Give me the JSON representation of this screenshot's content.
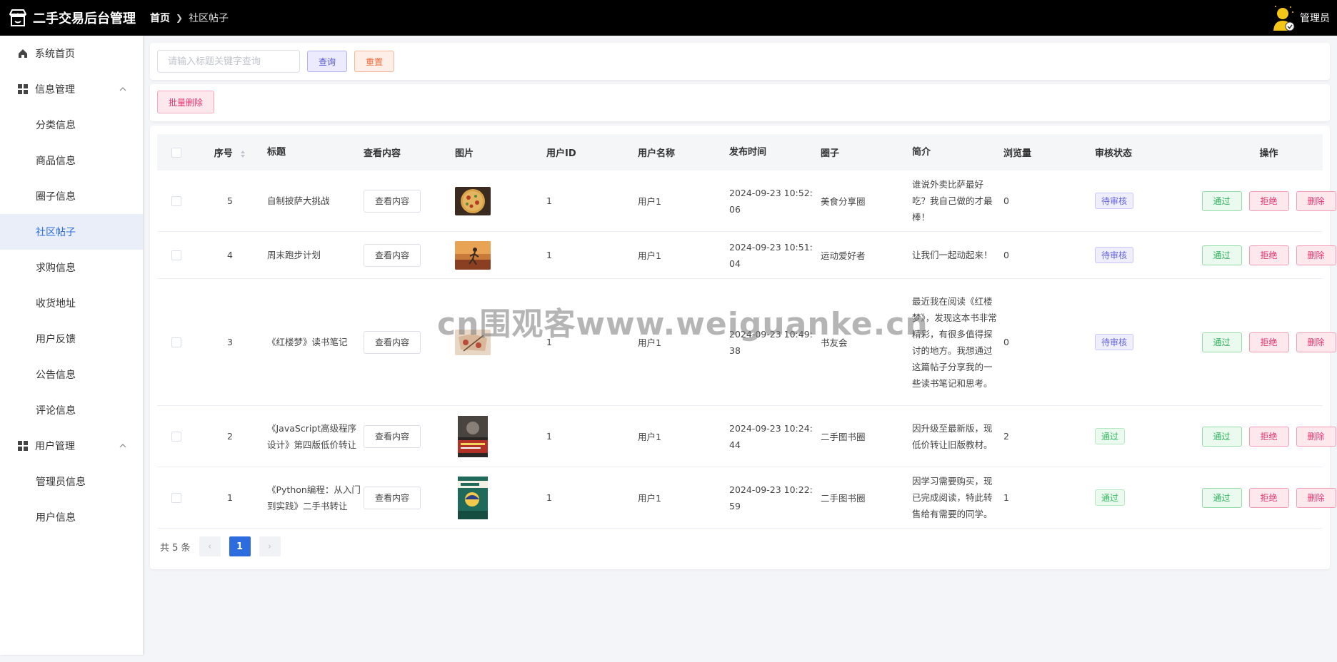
{
  "app": {
    "title": "二手交易后台管理",
    "user": "管理员"
  },
  "breadcrumb": {
    "home": "首页",
    "current": "社区帖子"
  },
  "sidebar": {
    "items": [
      {
        "label": "系统首页",
        "type": "top",
        "icon": "home-icon"
      },
      {
        "label": "信息管理",
        "type": "group",
        "icon": "grid-icon"
      },
      {
        "label": "分类信息",
        "type": "sub"
      },
      {
        "label": "商品信息",
        "type": "sub"
      },
      {
        "label": "圈子信息",
        "type": "sub"
      },
      {
        "label": "社区帖子",
        "type": "sub",
        "active": true
      },
      {
        "label": "求购信息",
        "type": "sub"
      },
      {
        "label": "收货地址",
        "type": "sub"
      },
      {
        "label": "用户反馈",
        "type": "sub"
      },
      {
        "label": "公告信息",
        "type": "sub"
      },
      {
        "label": "评论信息",
        "type": "sub"
      },
      {
        "label": "用户管理",
        "type": "group",
        "icon": "grid-icon"
      },
      {
        "label": "管理员信息",
        "type": "sub"
      },
      {
        "label": "用户信息",
        "type": "sub"
      }
    ]
  },
  "search": {
    "placeholder": "请输入标题关键字查询",
    "query_label": "查询",
    "reset_label": "重置"
  },
  "batch": {
    "delete_label": "批量删除"
  },
  "table": {
    "headers": [
      "序号",
      "标题",
      "查看内容",
      "图片",
      "用户ID",
      "用户名称",
      "发布时间",
      "圈子",
      "简介",
      "浏览量",
      "审核状态",
      "操作"
    ],
    "view_label": "查看内容",
    "ops": {
      "pass": "通过",
      "reject": "拒绝",
      "delete": "删除"
    },
    "rows": [
      {
        "idx": "5",
        "title": "自制披萨大挑战",
        "uid": "1",
        "uname": "用户1",
        "time": "2024-09-23 10:52:06",
        "circle": "美食分享圈",
        "intro": "谁说外卖比萨最好吃？我自己做的才最棒！",
        "views": "0",
        "status": "待审核",
        "status_type": "pending",
        "img": "pizza"
      },
      {
        "idx": "4",
        "title": "周末跑步计划",
        "uid": "1",
        "uname": "用户1",
        "time": "2024-09-23 10:51:04",
        "circle": "运动爱好者",
        "intro": "让我们一起动起来！",
        "views": "0",
        "status": "待审核",
        "status_type": "pending",
        "img": "run"
      },
      {
        "idx": "3",
        "title": "《红楼梦》读书笔记",
        "uid": "1",
        "uname": "用户1",
        "time": "2024-09-23 10:49:38",
        "circle": "书友会",
        "intro": "最近我在阅读《红楼梦》，发现这本书非常精彩，有很多值得探讨的地方。我想通过这篇帖子分享我的一些读书笔记和思考。",
        "views": "0",
        "status": "待审核",
        "status_type": "pending",
        "img": "book"
      },
      {
        "idx": "2",
        "title": "《JavaScript高级程序设计》第四版低价转让",
        "uid": "1",
        "uname": "用户1",
        "time": "2024-09-23 10:24:44",
        "circle": "二手图书圈",
        "intro": "因升级至最新版，现低价转让旧版教材。",
        "views": "2",
        "status": "通过",
        "status_type": "pass",
        "img": "js"
      },
      {
        "idx": "1",
        "title": "《Python编程：从入门到实践》二手书转让",
        "uid": "1",
        "uname": "用户1",
        "time": "2024-09-23 10:22:59",
        "circle": "二手图书圈",
        "intro": "因学习需要购买，现已完成阅读，特此转售给有需要的同学。",
        "views": "1",
        "status": "通过",
        "status_type": "pass",
        "img": "py"
      }
    ]
  },
  "pagination": {
    "total_text": "共 5 条",
    "current": "1",
    "prev": "‹",
    "next": "›"
  },
  "watermark": "cn围观客www.weiguanke.cn"
}
